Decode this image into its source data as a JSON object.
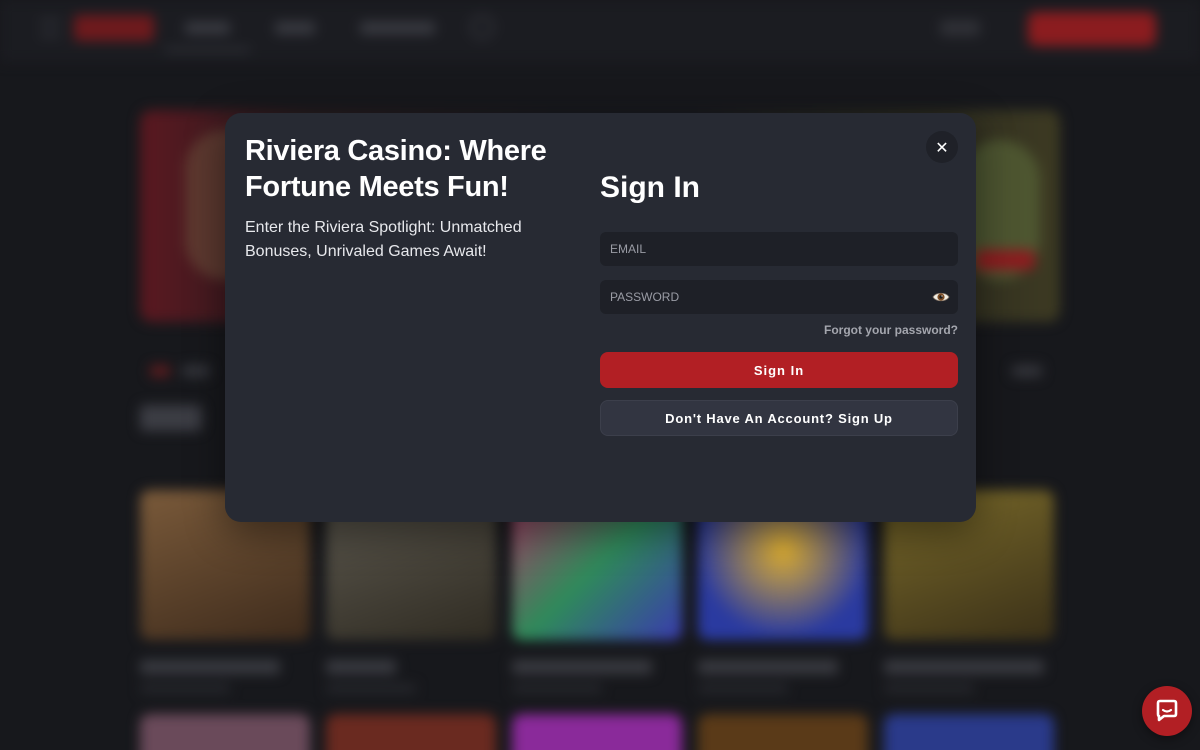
{
  "modal": {
    "promo_title": "Riviera Casino: Where Fortune Meets Fun!",
    "promo_text": "Enter the Riviera Spotlight: Unmatched Bonuses, Unrivaled Games Await!",
    "close_icon": "close-icon",
    "form": {
      "title": "Sign In",
      "email_placeholder": "EMAIL",
      "email_value": "",
      "password_placeholder": "PASSWORD",
      "password_value": "",
      "password_toggle_icon": "eye-icon",
      "forgot_password": "Forgot your password?",
      "submit_label": "Sign In",
      "signup_label": "Don't Have An Account? Sign Up"
    }
  },
  "chat_widget": {
    "icon": "chat-bubble-icon"
  },
  "colors": {
    "accent": "#b21f24",
    "modal_background": "#272a33",
    "page_background": "#17181c",
    "input_background": "#1e2027",
    "secondary_button": "#323541"
  }
}
